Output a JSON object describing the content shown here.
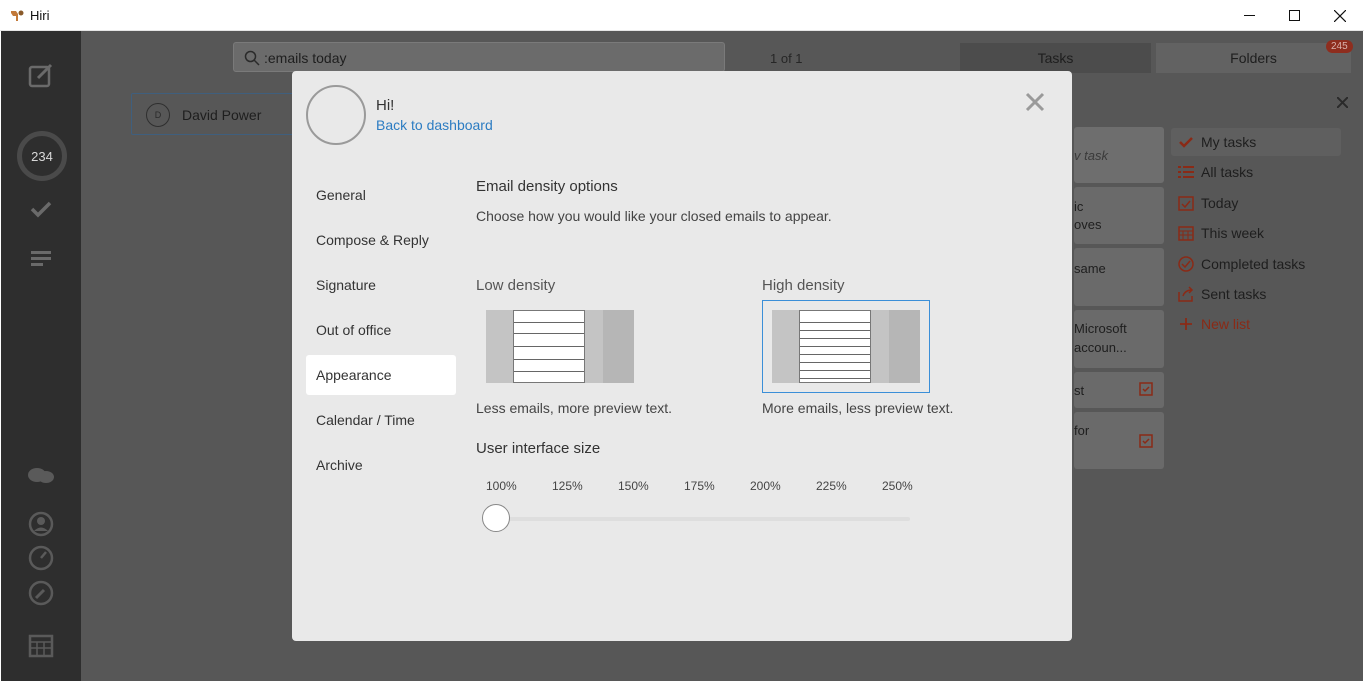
{
  "window": {
    "title": "Hiri"
  },
  "sidebar": {
    "unread_count": "234"
  },
  "app": {
    "search_value": ":emails today",
    "pager": "1 of 1",
    "tabs": [
      "Tasks",
      "Folders"
    ],
    "folders_badge": "245",
    "contact": {
      "initial": "D",
      "name": "David Power"
    },
    "task_cards": [
      {
        "lines": [
          "v task"
        ]
      },
      {
        "lines": [
          "ic",
          "oves"
        ]
      },
      {
        "lines": [
          "same"
        ]
      },
      {
        "lines": [
          "Microsoft",
          "accoun..."
        ]
      },
      {
        "lines": [
          "st"
        ]
      },
      {
        "lines": [
          "for"
        ]
      }
    ],
    "task_lists": [
      {
        "label": "My tasks",
        "icon": "check-icon"
      },
      {
        "label": "All tasks",
        "icon": "list-icon"
      },
      {
        "label": "Today",
        "icon": "calendar-check-icon"
      },
      {
        "label": "This week",
        "icon": "calendar-grid-icon"
      },
      {
        "label": "Completed tasks",
        "icon": "check-circle-icon"
      },
      {
        "label": "Sent tasks",
        "icon": "share-icon"
      },
      {
        "label": "New list",
        "icon": "plus-icon"
      }
    ]
  },
  "modal": {
    "greeting": "Hi!",
    "back_link": "Back to dashboard",
    "nav": [
      "General",
      "Compose & Reply",
      "Signature",
      "Out of office",
      "Appearance",
      "Calendar / Time",
      "Archive"
    ],
    "active_nav": "Appearance",
    "density": {
      "heading": "Email density options",
      "description": "Choose how you would like your closed emails to appear.",
      "low": {
        "label": "Low density",
        "caption": "Less emails, more preview text."
      },
      "high": {
        "label": "High density",
        "caption": "More emails, less preview text."
      },
      "selected": "High density"
    },
    "ui_size": {
      "heading": "User interface size",
      "ticks": [
        "100%",
        "125%",
        "150%",
        "175%",
        "200%",
        "225%",
        "250%"
      ],
      "value": "100%"
    }
  },
  "colors": {
    "accent": "#2c7cc2",
    "task_red": "#c0391b",
    "sidebar_bg": "#2e2e2e"
  }
}
